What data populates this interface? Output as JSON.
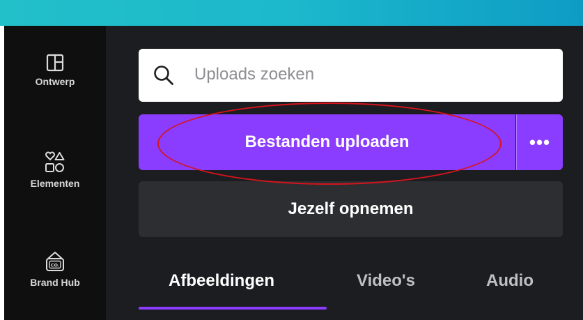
{
  "colors": {
    "accent": "#8b3dff",
    "topbar": "#1cb8cc",
    "sidebar_bg": "#0f0f10",
    "panel_bg": "#1c1d20",
    "annotation": "#d5141c"
  },
  "sidebar": {
    "items": [
      {
        "label": "Ontwerp",
        "icon": "layout-icon"
      },
      {
        "label": "Elementen",
        "icon": "shapes-icon"
      },
      {
        "label": "Brand Hub",
        "icon": "brand-hub-icon"
      }
    ]
  },
  "search": {
    "placeholder": "Uploads zoeken",
    "icon": "search-icon"
  },
  "actions": {
    "upload_label": "Bestanden uploaden",
    "more_label": "•••",
    "record_label": "Jezelf opnemen"
  },
  "tabs": [
    {
      "label": "Afbeeldingen",
      "active": true
    },
    {
      "label": "Video's",
      "active": false
    },
    {
      "label": "Audio",
      "active": false
    }
  ]
}
